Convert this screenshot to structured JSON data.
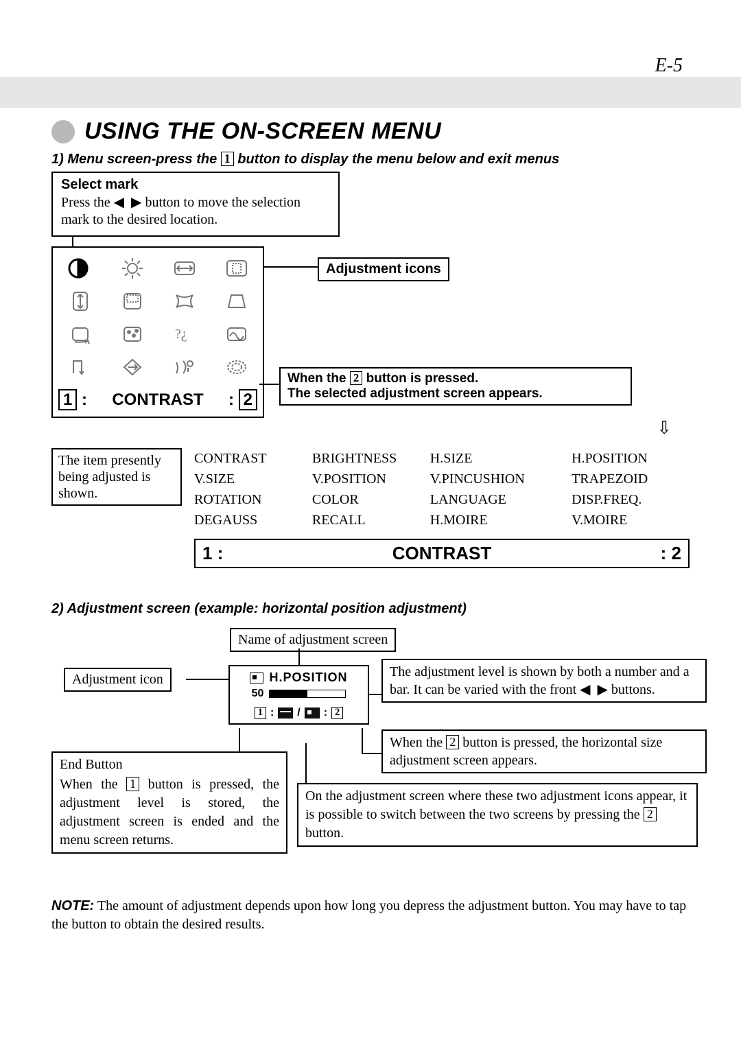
{
  "page_number": "E-5",
  "title": "USING THE ON-SCREEN MENU",
  "step1": {
    "prefix": "1) Menu screen-press the ",
    "button": "1",
    "suffix": " button to display the menu below and exit menus"
  },
  "select_mark": {
    "title": "Select mark",
    "line1_a": "Press the ",
    "line1_b": " button to move the selection",
    "line2": "mark to the desired location."
  },
  "adjustment_icons_label": "Adjustment icons",
  "menu_panel": {
    "left_num": "1",
    "label": "CONTRAST",
    "right_num": "2"
  },
  "button2_callout": {
    "line1_a": "When the ",
    "line1_num": "2",
    "line1_b": " button is pressed.",
    "line2": "The selected adjustment screen appears."
  },
  "current_item_text": "The item presently being adjusted is shown.",
  "adjustments": {
    "col1": [
      "CONTRAST",
      "V.SIZE",
      "ROTATION",
      "DEGAUSS"
    ],
    "col2": [
      "BRIGHTNESS",
      "V.POSITION",
      "COLOR",
      "RECALL"
    ],
    "col3": [
      "H.SIZE",
      "V.PINCUSHION",
      "LANGUAGE",
      "H.MOIRE"
    ],
    "col4": [
      "H.POSITION",
      "TRAPEZOID",
      "DISP.FREQ.",
      "V.MOIRE"
    ]
  },
  "footer_bar": {
    "left_num": "1",
    "center": "CONTRAST",
    "right_num": "2"
  },
  "step2_heading": "2) Adjustment screen (example: horizontal position adjustment)",
  "sec2": {
    "name_label": "Name of adjustment screen",
    "adj_icon_label": "Adjustment icon",
    "osd_title": "H.POSITION",
    "osd_value": "50",
    "osd_footer_left": "1",
    "osd_footer_right": "2",
    "level_box_a": "The adjustment level is shown by both a number and a bar. It can be varied with the front ",
    "level_box_b": " buttons.",
    "btn2_box_a": "When the ",
    "btn2_box_num": "2",
    "btn2_box_b": " button is pressed, the horizontal size adjustment screen appears.",
    "end_button_title": "End Button",
    "end_button_body_a": "When the ",
    "end_button_body_num": "1",
    "end_button_body_b": " button is pressed, the adjustment level is stored, the adjustment screen is ended and the menu screen returns.",
    "switch_box_a": "On the adjustment screen where these two adjustment icons appear, it is possible to switch between the two screens by pressing the ",
    "switch_box_num": "2",
    "switch_box_b": " button."
  },
  "note": {
    "label": "NOTE:",
    "body": " The amount of adjustment depends upon how long you depress the adjustment button. You may have to tap the button to obtain the desired results."
  }
}
